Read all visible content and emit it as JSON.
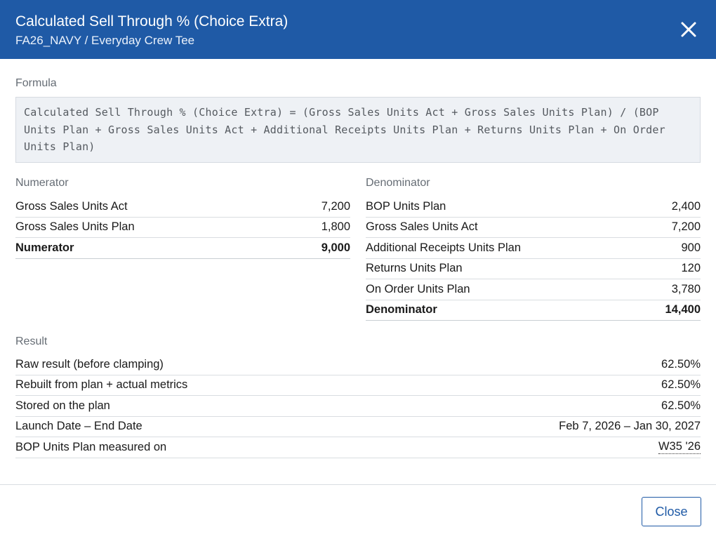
{
  "header": {
    "title": "Calculated Sell Through % (Choice Extra)",
    "subtitle": "FA26_NAVY / Everyday Crew Tee",
    "close_icon": "close-icon"
  },
  "formula": {
    "label": "Formula",
    "text": "Calculated Sell Through % (Choice Extra) = (Gross Sales Units Act + Gross Sales Units Plan) / (BOP Units Plan + Gross Sales Units Act + Additional Receipts Units Plan + Returns Units Plan + On Order Units Plan)"
  },
  "numerator": {
    "label": "Numerator",
    "rows": [
      {
        "label": "Gross Sales Units Act",
        "value": "7,200"
      },
      {
        "label": "Gross Sales Units Plan",
        "value": "1,800"
      }
    ],
    "total": {
      "label": "Numerator",
      "value": "9,000"
    }
  },
  "denominator": {
    "label": "Denominator",
    "rows": [
      {
        "label": "BOP Units Plan",
        "value": "2,400"
      },
      {
        "label": "Gross Sales Units Act",
        "value": "7,200"
      },
      {
        "label": "Additional Receipts Units Plan",
        "value": "900"
      },
      {
        "label": "Returns Units Plan",
        "value": "120"
      },
      {
        "label": "On Order Units Plan",
        "value": "3,780"
      }
    ],
    "total": {
      "label": "Denominator",
      "value": "14,400"
    }
  },
  "result": {
    "label": "Result",
    "rows": [
      {
        "label": "Raw result (before clamping)",
        "value": "62.50%"
      },
      {
        "label": "Rebuilt from plan + actual metrics",
        "value": "62.50%"
      },
      {
        "label": "Stored on the plan",
        "value": "62.50%"
      },
      {
        "label": "Launch Date – End Date",
        "value": "Feb 7, 2026 – Jan 30, 2027"
      },
      {
        "label": "BOP Units Plan measured on",
        "value": "W35 '26"
      }
    ]
  },
  "footer": {
    "close_label": "Close"
  },
  "colors": {
    "header_bg": "#1f5aa6",
    "accent": "#1f5aa6"
  }
}
